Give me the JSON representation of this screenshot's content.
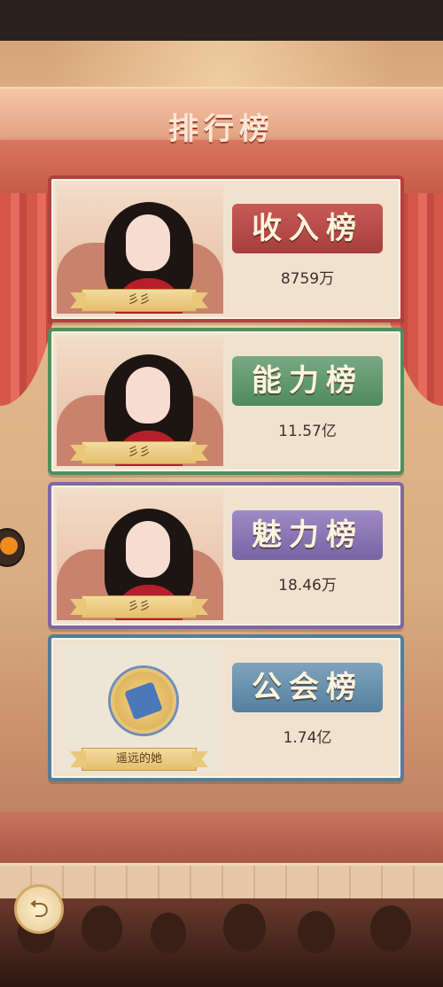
{
  "header": {
    "title": "排行榜"
  },
  "boards": [
    {
      "name": "收入榜",
      "value": "8759万",
      "holder": "彡彡",
      "accent": "#b3413d"
    },
    {
      "name": "能力榜",
      "value": "11.57亿",
      "holder": "彡彡",
      "accent": "#4d8f5d"
    },
    {
      "name": "魅力榜",
      "value": "18.46万",
      "holder": "彡彡",
      "accent": "#7f66a8"
    },
    {
      "name": "公会榜",
      "value": "1.74亿",
      "holder": "遥远的她",
      "accent": "#4f7f9a"
    }
  ],
  "icons": {
    "back": "back-arrow-icon",
    "guild_emblem": "guild-emblem-icon",
    "side_tab": "side-tab-icon"
  }
}
